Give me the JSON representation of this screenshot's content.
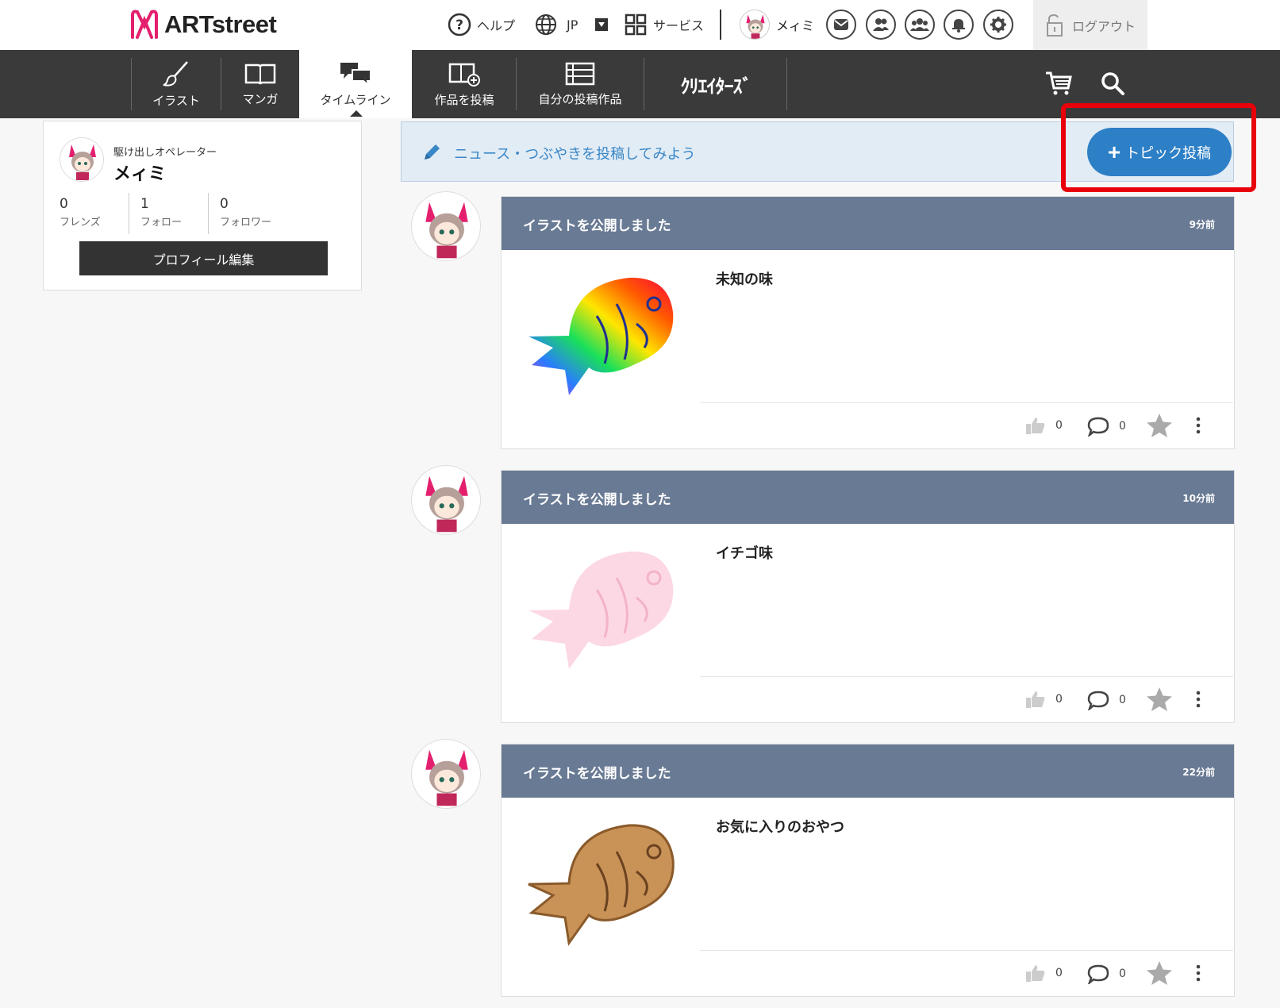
{
  "header": {
    "logo_text": "ARTstreet",
    "help_label": "ヘルプ",
    "language_label": "JP",
    "services_label": "サービス",
    "user_name": "メィミ",
    "logout_label": "ログアウト"
  },
  "nav": {
    "items": [
      {
        "label": "イラスト"
      },
      {
        "label": "マンガ"
      },
      {
        "label": "タイムライン"
      },
      {
        "label": "作品を投稿"
      },
      {
        "label": "自分の投稿作品"
      }
    ],
    "creators_label": "ｸﾘｴｲﾀｰｽﾞ"
  },
  "profile": {
    "title": "駆け出しオペレーター",
    "name": "メィミ",
    "stats": [
      {
        "count": "0",
        "label": "フレンズ"
      },
      {
        "count": "1",
        "label": "フォロー"
      },
      {
        "count": "0",
        "label": "フォロワー"
      }
    ],
    "edit_label": "プロフィール編集"
  },
  "composer": {
    "prompt": "ニュース・つぶやきを投稿してみよう",
    "topic_button": "トピック投稿"
  },
  "posts": [
    {
      "heading": "イラストを公開しました",
      "time": "9分前",
      "title": "未知の味",
      "likes": "0",
      "comments": "0",
      "thumb": "rainbow-taiyaki"
    },
    {
      "heading": "イラストを公開しました",
      "time": "10分前",
      "title": "イチゴ味",
      "likes": "0",
      "comments": "0",
      "thumb": "pink-taiyaki"
    },
    {
      "heading": "イラストを公開しました",
      "time": "22分前",
      "title": "お気に入りのおやつ",
      "likes": "0",
      "comments": "0",
      "thumb": "brown-taiyaki"
    }
  ],
  "colors": {
    "nav_bg": "#3a3a3a",
    "post_header": "#697a94",
    "accent_blue": "#2d7fc6",
    "highlight_red": "#e8000b",
    "brand_pink": "#e4206e"
  }
}
